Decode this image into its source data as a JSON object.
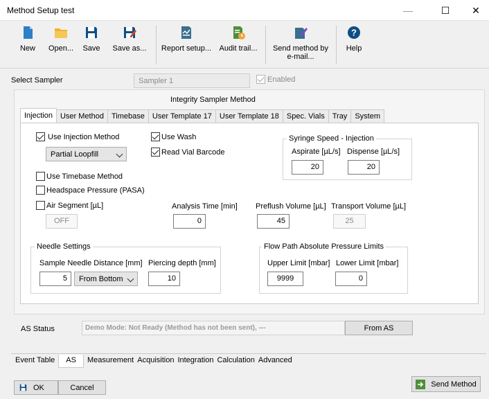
{
  "window": {
    "title": "Method Setup test",
    "minimize": "—",
    "maximize": "☐",
    "close": "✕"
  },
  "toolbar": {
    "new": "New",
    "open": "Open...",
    "save": "Save",
    "save_as": "Save as...",
    "report_setup": "Report setup...",
    "audit_trail": "Audit trail...",
    "send_email_line1": "Send method by",
    "send_email_line2": "e-mail...",
    "help": "Help"
  },
  "colors": {
    "accent": "#0d4e86",
    "folder": "#f2b233",
    "green": "#4f8f3a"
  },
  "sampler": {
    "label": "Select Sampler",
    "value": "Sampler 1",
    "enabled_label": "Enabled",
    "enabled": true
  },
  "method_title": "Integrity Sampler Method",
  "tabs": [
    "Injection",
    "User Method",
    "Timebase",
    "User Template 17",
    "User Template 18",
    "Spec. Vials",
    "Tray",
    "System"
  ],
  "injection": {
    "use_injection_method": "Use Injection Method",
    "injection_mode": "Partial Loopfill",
    "use_wash": "Use Wash",
    "read_vial_barcode": "Read Vial Barcode",
    "syringe_group": "Syringe Speed - Injection",
    "aspirate_label": "Aspirate [µL/s]",
    "aspirate_value": "20",
    "dispense_label": "Dispense [µL/s]",
    "dispense_value": "20",
    "use_timebase": "Use Timebase Method",
    "headspace": "Headspace Pressure (PASA)",
    "air_segment": "Air Segment  [µL]",
    "air_segment_value": "OFF",
    "analysis_time_label": "Analysis Time [min]",
    "analysis_time_value": "0",
    "preflush_label": "Preflush Volume [µL]",
    "preflush_value": "45",
    "transport_label": "Transport Volume [µL]",
    "transport_value": "25",
    "needle_group": "Needle Settings",
    "needle_distance_label": "Sample Needle Distance [mm]",
    "needle_distance_value": "5",
    "needle_reference": "From Bottom",
    "piercing_label": "Piercing depth [mm]",
    "piercing_value": "10",
    "flow_group": "Flow Path Absolute Pressure Limits",
    "upper_label": "Upper Limit [mbar]",
    "upper_value": "9999",
    "lower_label": "Lower Limit [mbar]",
    "lower_value": "0"
  },
  "status": {
    "label": "AS Status",
    "text": "Demo Mode: Not Ready (Method has not been sent), ---",
    "from_as": "From AS"
  },
  "bottom_tabs": [
    "Event Table",
    "AS",
    "Measurement",
    "Acquisition",
    "Integration",
    "Calculation",
    "Advanced"
  ],
  "footer": {
    "ok": "OK",
    "cancel": "Cancel",
    "send_method": "Send Method"
  }
}
